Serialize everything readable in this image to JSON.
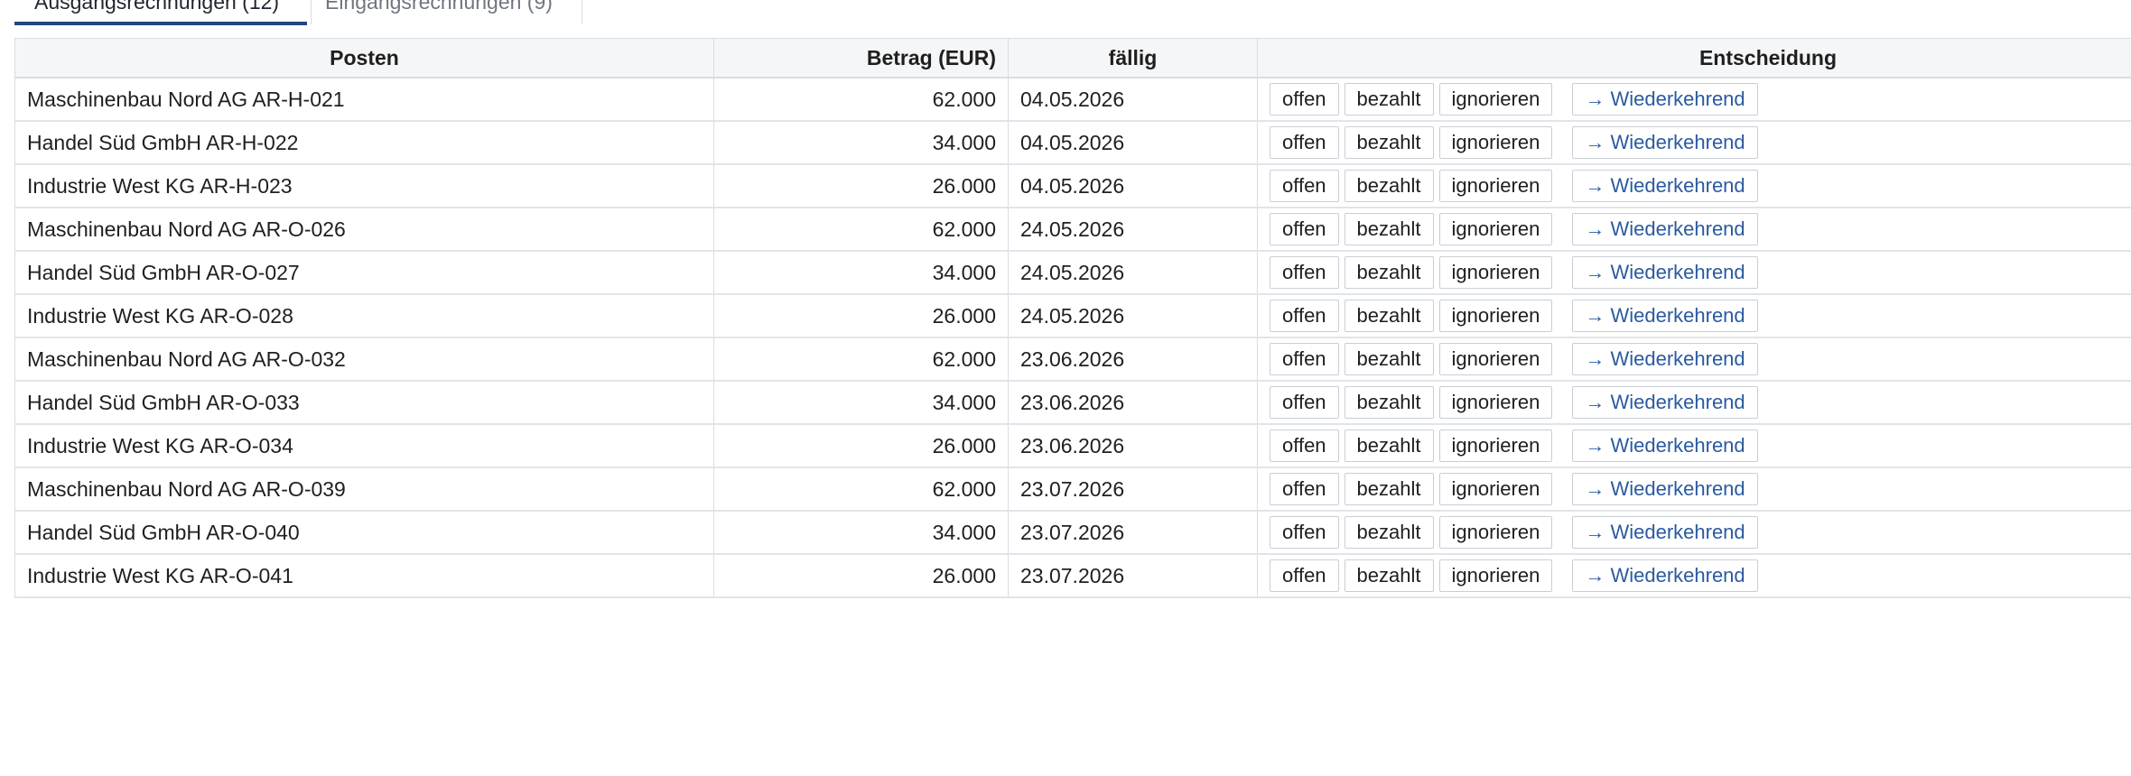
{
  "tabs": [
    {
      "label": "Ausgangsrechnungen (12)",
      "active": true
    },
    {
      "label": "Eingangsrechnungen (9)",
      "active": false
    }
  ],
  "table": {
    "headers": {
      "posten": "Posten",
      "betrag": "Betrag (EUR)",
      "faellig": "fällig",
      "entscheidung": "Entscheidung"
    },
    "actions": {
      "offen": "offen",
      "bezahlt": "bezahlt",
      "ignorieren": "ignorieren",
      "wiederkehrend": "→ Wiederkehrend"
    },
    "rows": [
      {
        "posten": "Maschinenbau Nord AG AR-H-021",
        "betrag": "62.000",
        "faellig": "04.05.2026"
      },
      {
        "posten": "Handel Süd GmbH AR-H-022",
        "betrag": "34.000",
        "faellig": "04.05.2026"
      },
      {
        "posten": "Industrie West KG AR-H-023",
        "betrag": "26.000",
        "faellig": "04.05.2026"
      },
      {
        "posten": "Maschinenbau Nord AG AR-O-026",
        "betrag": "62.000",
        "faellig": "24.05.2026"
      },
      {
        "posten": "Handel Süd GmbH AR-O-027",
        "betrag": "34.000",
        "faellig": "24.05.2026"
      },
      {
        "posten": "Industrie West KG AR-O-028",
        "betrag": "26.000",
        "faellig": "24.05.2026"
      },
      {
        "posten": "Maschinenbau Nord AG AR-O-032",
        "betrag": "62.000",
        "faellig": "23.06.2026"
      },
      {
        "posten": "Handel Süd GmbH AR-O-033",
        "betrag": "34.000",
        "faellig": "23.06.2026"
      },
      {
        "posten": "Industrie West KG AR-O-034",
        "betrag": "26.000",
        "faellig": "23.06.2026"
      },
      {
        "posten": "Maschinenbau Nord AG AR-O-039",
        "betrag": "62.000",
        "faellig": "23.07.2026"
      },
      {
        "posten": "Handel Süd GmbH AR-O-040",
        "betrag": "34.000",
        "faellig": "23.07.2026"
      },
      {
        "posten": "Industrie West KG AR-O-041",
        "betrag": "26.000",
        "faellig": "23.07.2026"
      }
    ]
  },
  "colors": {
    "accent": "#27457d",
    "link": "#2a5aa0",
    "header_bg": "#f5f6f8",
    "border": "#d9dde3"
  }
}
